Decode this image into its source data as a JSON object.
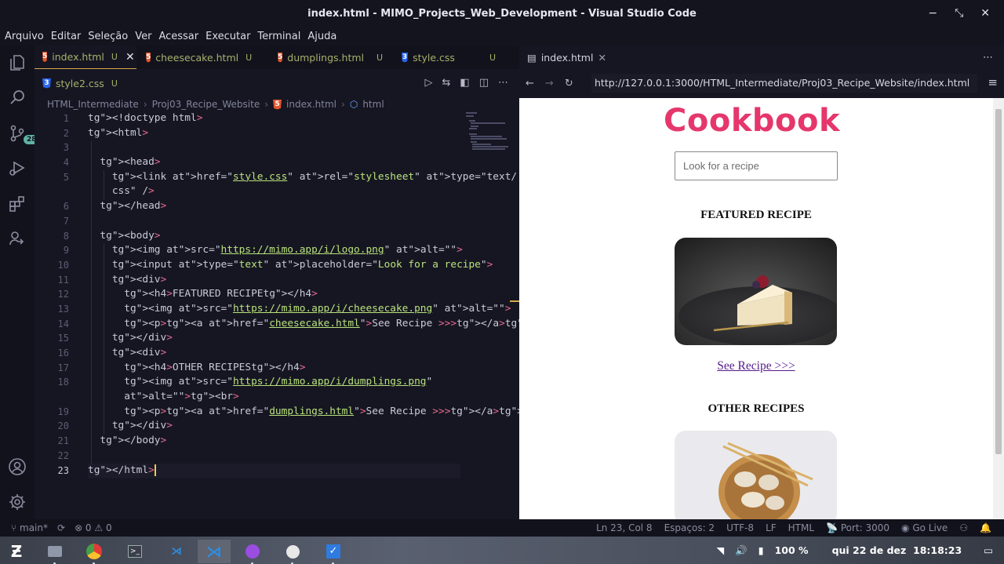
{
  "window": {
    "title": "index.html - MIMO_Projects_Web_Development - Visual Studio Code",
    "controls": [
      "−",
      "⤡",
      "✕"
    ]
  },
  "menu": [
    "Arquivo",
    "Editar",
    "Seleção",
    "Ver",
    "Acessar",
    "Executar",
    "Terminal",
    "Ajuda"
  ],
  "activity": {
    "scm_badge": "28"
  },
  "tabs": [
    {
      "label": "index.html",
      "status": "U",
      "icon": "html5-icon",
      "close": "✕"
    },
    {
      "label": "cheesecake.html",
      "status": "U",
      "icon": "html5-icon"
    },
    {
      "label": "dumplings.html",
      "status": "U",
      "icon": "html5-icon"
    },
    {
      "label": "style.css",
      "status": "U",
      "icon": "css3-icon"
    },
    {
      "label": "style2.css",
      "status": "U",
      "icon": "css3-icon"
    }
  ],
  "breadcrumb": [
    "HTML_Intermediate",
    "Proj03_Recipe_Website",
    "index.html",
    "html"
  ],
  "gutter": [
    "1",
    "2",
    "3",
    "4",
    "5",
    "",
    "6",
    "7",
    "8",
    "9",
    "10",
    "11",
    "12",
    "13",
    "14",
    "15",
    "16",
    "17",
    "18",
    "",
    "19",
    "20",
    "21",
    "22",
    "23"
  ],
  "code": [
    "<!doctype html>",
    "<html>",
    "",
    "  <head>",
    "    <link href=\"style.css\" rel=\"stylesheet\" type=\"text/",
    "    css\" />",
    "  </head>",
    "",
    "  <body>",
    "    <img src=\"https://mimo.app/i/logo.png\" alt=\"\">",
    "    <input type=\"text\" placeholder=\"Look for a recipe\">",
    "    <div>",
    "      <h4>FEATURED RECIPE</h4>",
    "      <img src=\"https://mimo.app/i/cheesecake.png\" alt=\"\">",
    "      <p><a href=\"cheesecake.html\">See Recipe >>></a></p>",
    "    </div>",
    "    <div>",
    "      <h4>OTHER RECIPES</h4>",
    "      <img src=\"https://mimo.app/i/dumplings.png\"",
    "      alt=\"\"><br>",
    "      <p><a href=\"dumplings.html\">See Recipe >>></a></p>",
    "    </div>",
    "  </body>",
    "",
    "</html>"
  ],
  "browser": {
    "tab_label": "index.html",
    "url": "http://127.0.0.1:3000/HTML_Intermediate/Proj03_Recipe_Website/index.html",
    "page": {
      "logo_text": "Cookbook",
      "search_placeholder": "Look for a recipe",
      "featured_heading": "FEATURED RECIPE",
      "featured_link": "See Recipe >>>",
      "other_heading": "OTHER RECIPES"
    }
  },
  "status": {
    "branch": "main*",
    "problems": "⊗ 0 ⚠ 0",
    "cursor": "Ln 23, Col 8",
    "spaces": "Espaços: 2",
    "encoding": "UTF-8",
    "eol": "LF",
    "language": "HTML",
    "port": "Port: 3000",
    "golive": "Go Live"
  },
  "taskbar": {
    "battery": "100 %",
    "clock": "qui 22 de dez  18:18:23"
  }
}
